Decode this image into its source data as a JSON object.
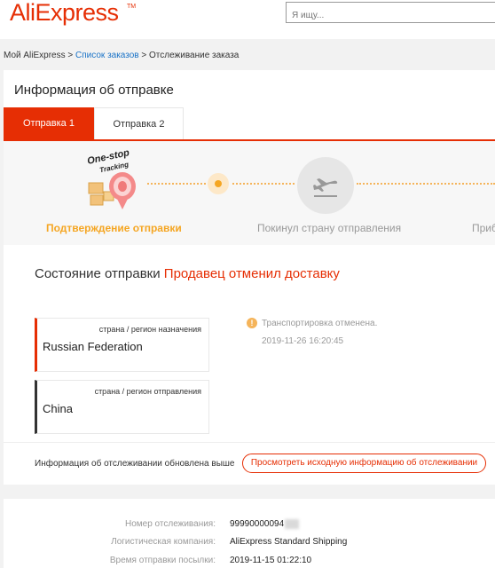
{
  "header": {
    "logo": "AliExpress",
    "logo_tm": "TM",
    "search_placeholder": "Я ищу..."
  },
  "breadcrumb": {
    "home": "Мой AliExpress",
    "sep1": " > ",
    "orders": "Список заказов",
    "sep2": " > ",
    "current": "Отслеживание заказа"
  },
  "shipping": {
    "title": "Информация об отправке",
    "tabs": [
      {
        "label": "Отправка 1",
        "active": true
      },
      {
        "label": "Отправка 2",
        "active": false
      }
    ],
    "badge_line1": "One-stop",
    "badge_line2": "Tracking",
    "steps": [
      {
        "label": "Подтверждение отправки",
        "state": "current"
      },
      {
        "label": "Покинул страну отправления",
        "state": "pending"
      },
      {
        "label": "Приб",
        "state": "pending"
      }
    ],
    "status_prefix": "Состояние отправки",
    "status_value": "Продавец отменил доставку",
    "destination": {
      "label": "страна / регион назначения",
      "value": "Russian Federation"
    },
    "origin": {
      "label": "страна / регион отправления",
      "value": "China"
    },
    "event": {
      "icon": "info-icon",
      "text": "Транспортировка отменена.",
      "time": "2019-11-26 16:20:45"
    },
    "updated_text": "Информация об отслеживании обновлена выше",
    "original_button": "Просмотреть исходную информацию об отслеживании"
  },
  "details": {
    "tracking_label": "Номер отслеживания:",
    "tracking_value": "99990000094",
    "carrier_label": "Логистическая компания:",
    "carrier_value": "AliExpress Standard Shipping",
    "sent_label": "Время отправки посылки:",
    "sent_value": "2019-11-15 01:22:10"
  },
  "colors": {
    "accent": "#e62e04",
    "step_active": "#f5a623",
    "link": "#1a73c7"
  }
}
